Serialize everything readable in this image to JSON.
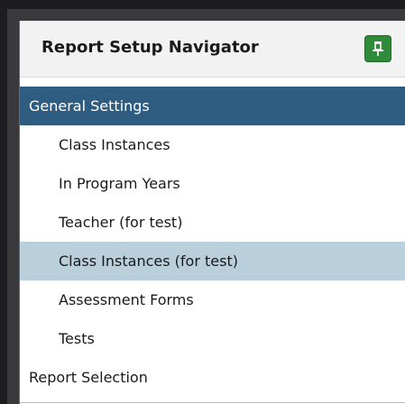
{
  "navigator": {
    "title": "Report Setup Navigator",
    "pin_icon": "pin-icon",
    "items": [
      {
        "label": "General Settings"
      },
      {
        "label": "Class Instances"
      },
      {
        "label": "In Program Years"
      },
      {
        "label": "Teacher (for test)"
      },
      {
        "label": "Class Instances (for test)"
      },
      {
        "label": "Assessment Forms"
      },
      {
        "label": "Tests"
      },
      {
        "label": "Report Selection"
      }
    ]
  },
  "colors": {
    "section_header": "#2f5d81",
    "selected_row": "#b9cfdc",
    "pin_button": "#2f8a3a"
  }
}
